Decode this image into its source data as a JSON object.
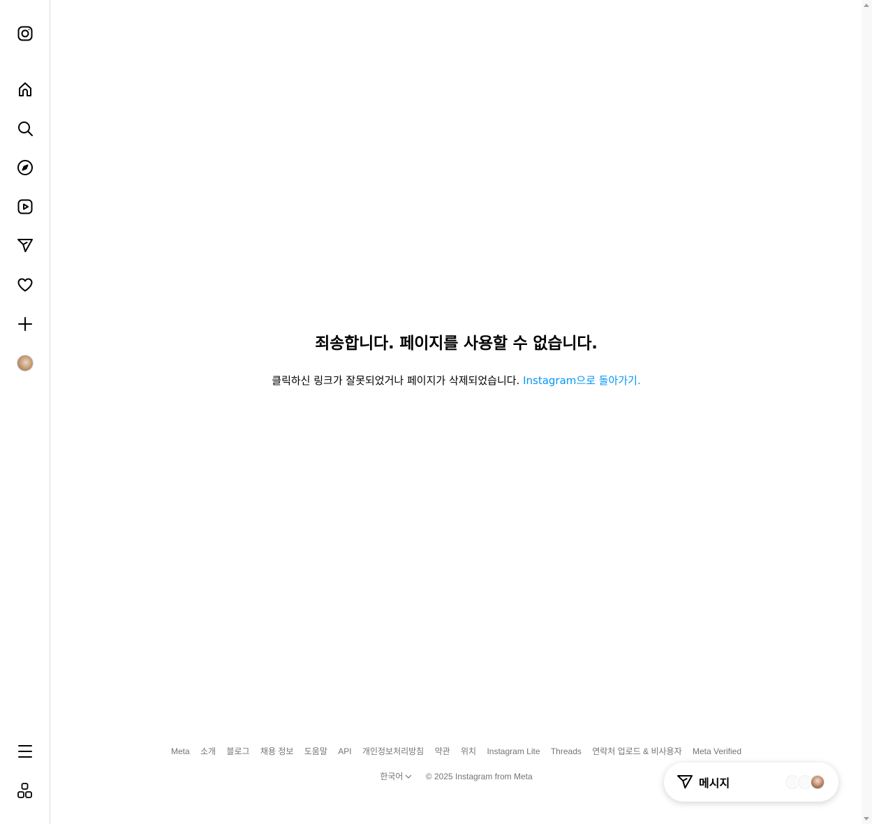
{
  "sidebar": {
    "items": [
      {
        "name": "instagram-logo-icon",
        "label": "Instagram"
      },
      {
        "name": "home-icon",
        "label": "홈"
      },
      {
        "name": "search-icon",
        "label": "검색"
      },
      {
        "name": "explore-icon",
        "label": "탐색 탭"
      },
      {
        "name": "reels-icon",
        "label": "릴스"
      },
      {
        "name": "messages-icon",
        "label": "메시지"
      },
      {
        "name": "notifications-icon",
        "label": "알림"
      },
      {
        "name": "create-icon",
        "label": "만들기"
      },
      {
        "name": "profile-avatar",
        "label": "프로필"
      },
      {
        "name": "more-menu-icon",
        "label": "더 보기"
      },
      {
        "name": "also-from-meta-icon",
        "label": "Meta의 다른 앱"
      }
    ]
  },
  "main": {
    "title": "죄송합니다. 페이지를 사용할 수 없습니다.",
    "description": "클릭하신 링크가 잘못되었거나 페이지가 삭제되었습니다. ",
    "back_link": "Instagram으로 돌아가기."
  },
  "footer": {
    "links": [
      "Meta",
      "소개",
      "블로그",
      "채용 정보",
      "도움말",
      "API",
      "개인정보처리방침",
      "약관",
      "위치",
      "Instagram Lite",
      "Threads",
      "연락처 업로드 & 비사용자",
      "Meta Verified"
    ],
    "language": "한국어",
    "copyright": "© 2025 Instagram from Meta"
  },
  "messages_button": {
    "label": "메시지",
    "avatars": [
      "",
      "",
      ""
    ]
  }
}
